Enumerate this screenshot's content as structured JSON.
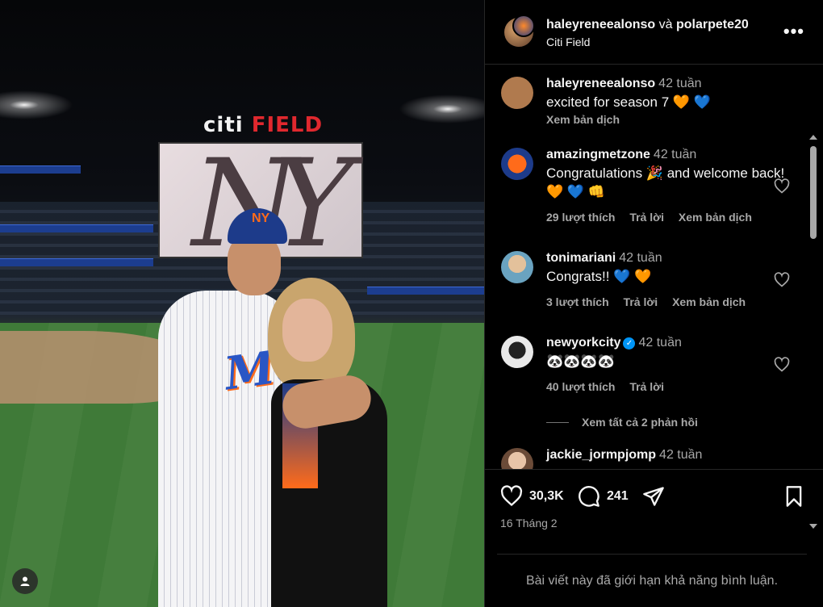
{
  "post": {
    "author": "haleyreneealonso",
    "collab_joiner": "và",
    "collaborator": "polarpete20",
    "location": "Citi Field",
    "photo": {
      "stadium_sign_citi": "citi",
      "stadium_sign_field": "FIELD"
    }
  },
  "comments": [
    {
      "user": "haleyreneealonso",
      "time": "42 tuần",
      "text": "excited for season 7 🧡 💙",
      "translate": "Xem bản dịch",
      "avatar_color": "#b07a4e"
    },
    {
      "user": "amazingmetzone",
      "time": "42 tuần",
      "text": "Congratulations 🎉 and welcome back! 🧡 💙 👊",
      "likes": "29 lượt thích",
      "reply": "Trả lời",
      "translate": "Xem bản dịch",
      "avatar_color": "#1d3b8a"
    },
    {
      "user": "tonimariani",
      "time": "42 tuần",
      "text": "Congrats!! 💙 🧡",
      "likes": "3 lượt thích",
      "reply": "Trả lời",
      "translate": "Xem bản dịch",
      "avatar_color": "#6aa3c0"
    },
    {
      "user": "newyorkcity",
      "time": "42 tuần",
      "text": "🐼🐼🐼🐼",
      "likes": "40 lượt thích",
      "reply": "Trả lời",
      "verified": true,
      "avatar_color": "#e9e9e9"
    },
    {
      "user": "jackie_jormpjomp",
      "time": "42 tuần",
      "avatar_color": "#c9a98a"
    }
  ],
  "view_replies": "Xem tất cả 2 phản hồi",
  "actions": {
    "likes": "30,3K",
    "comments": "241"
  },
  "date": "16 Tháng 2",
  "comments_limited": "Bài viết này đã giới hạn khả năng bình luận.",
  "icons": {
    "like": "heart-icon",
    "comment": "comment-icon",
    "share": "share-icon",
    "save": "bookmark-icon",
    "more": "more-icon",
    "tagged_people": "person-icon"
  },
  "colors": {
    "background": "#000000",
    "text": "#f5f5f5",
    "muted": "#a8a8a8",
    "verified": "#0095f6",
    "divider": "#262626"
  }
}
